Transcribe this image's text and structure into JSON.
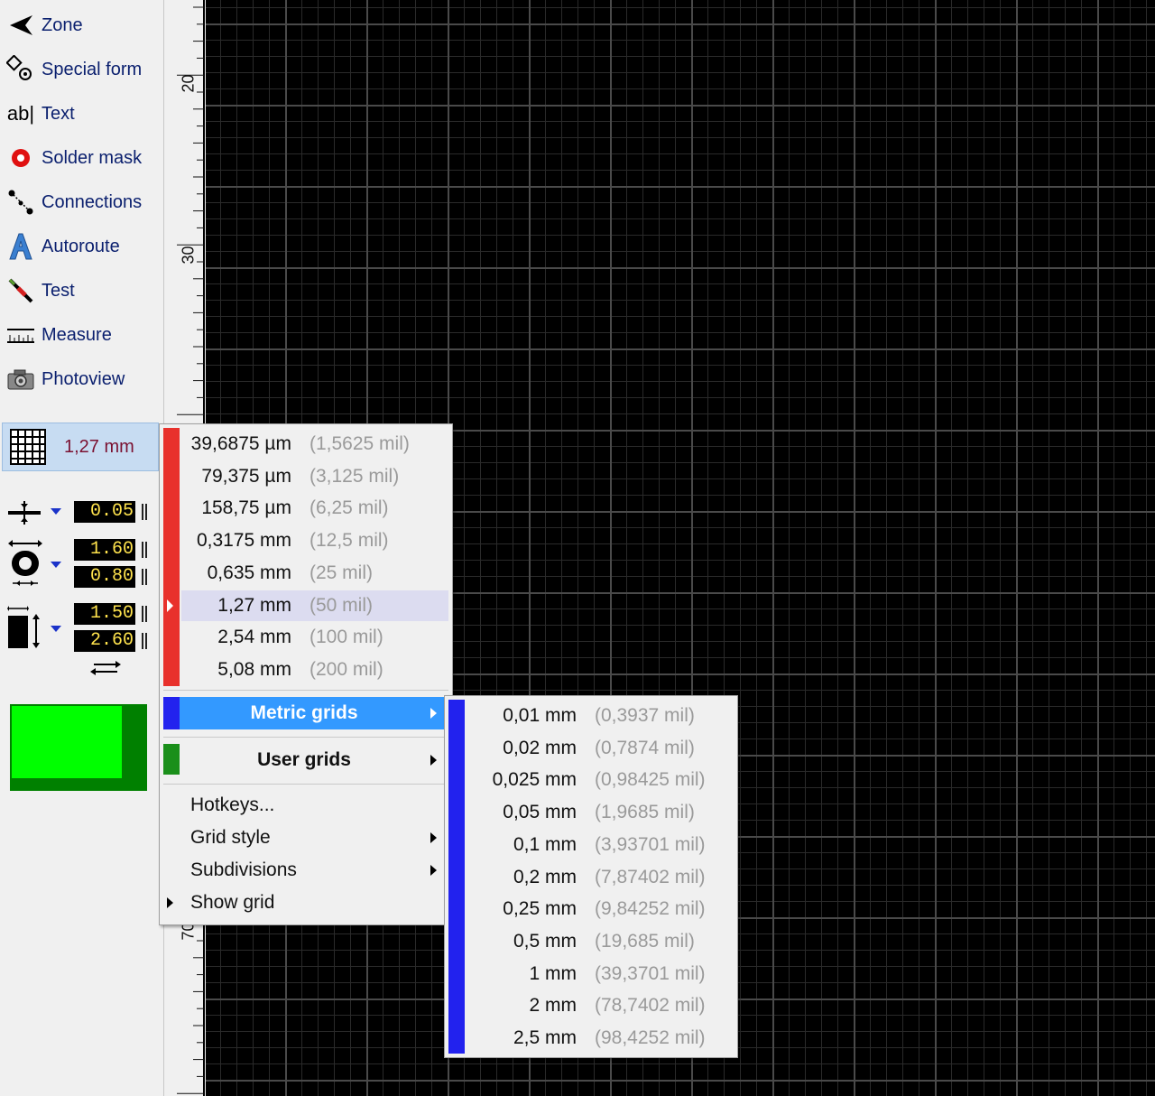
{
  "toolbar": {
    "tools": [
      {
        "label": "Zone",
        "icon": "zone-icon"
      },
      {
        "label": "Special form",
        "icon": "special-form-icon"
      },
      {
        "label": "Text",
        "icon": "text-tool-icon"
      },
      {
        "label": "Solder mask",
        "icon": "solder-mask-icon"
      },
      {
        "label": "Connections",
        "icon": "connections-icon"
      },
      {
        "label": "Autoroute",
        "icon": "autoroute-icon"
      },
      {
        "label": "Test",
        "icon": "test-probe-icon"
      },
      {
        "label": "Measure",
        "icon": "measure-icon"
      },
      {
        "label": "Photoview",
        "icon": "camera-icon"
      }
    ],
    "text_icon_glyph": "ab|",
    "grid_button_label": "1,27 mm",
    "track_width": "0.05",
    "pad_outer": "1.60",
    "pad_inner": "0.80",
    "smd_width": "1.50",
    "smd_height": "2.60",
    "active_color": "#00ff00"
  },
  "ruler": {
    "labels": [
      "20",
      "30",
      "70"
    ]
  },
  "grid_menu": {
    "presets": [
      {
        "value": "39,6875 µm",
        "mil": "(1,5625 mil)"
      },
      {
        "value": "79,375 µm",
        "mil": "(3,125 mil)"
      },
      {
        "value": "158,75 µm",
        "mil": "(6,25 mil)"
      },
      {
        "value": "0,3175 mm",
        "mil": "(12,5 mil)"
      },
      {
        "value": "0,635 mm",
        "mil": "(25 mil)"
      },
      {
        "value": "1,27 mm",
        "mil": "(50 mil)"
      },
      {
        "value": "2,54 mm",
        "mil": "(100 mil)"
      },
      {
        "value": "5,08 mm",
        "mil": "(200 mil)"
      }
    ],
    "metric_label": "Metric grids",
    "user_label": "User grids",
    "hotkeys_label": "Hotkeys...",
    "grid_style_label": "Grid style",
    "subdivisions_label": "Subdivisions",
    "show_grid_label": "Show grid"
  },
  "metric_submenu": {
    "items": [
      {
        "value": "0,01 mm",
        "mil": "(0,3937 mil)"
      },
      {
        "value": "0,02 mm",
        "mil": "(0,7874 mil)"
      },
      {
        "value": "0,025 mm",
        "mil": "(0,98425 mil)"
      },
      {
        "value": "0,05 mm",
        "mil": "(1,9685 mil)"
      },
      {
        "value": "0,1 mm",
        "mil": "(3,93701 mil)"
      },
      {
        "value": "0,2 mm",
        "mil": "(7,87402 mil)"
      },
      {
        "value": "0,25 mm",
        "mil": "(9,84252 mil)"
      },
      {
        "value": "0,5 mm",
        "mil": "(19,685 mil)"
      },
      {
        "value": "1 mm",
        "mil": "(39,3701 mil)"
      },
      {
        "value": "2 mm",
        "mil": "(78,7402 mil)"
      },
      {
        "value": "2,5 mm",
        "mil": "(98,4252 mil)"
      }
    ]
  }
}
